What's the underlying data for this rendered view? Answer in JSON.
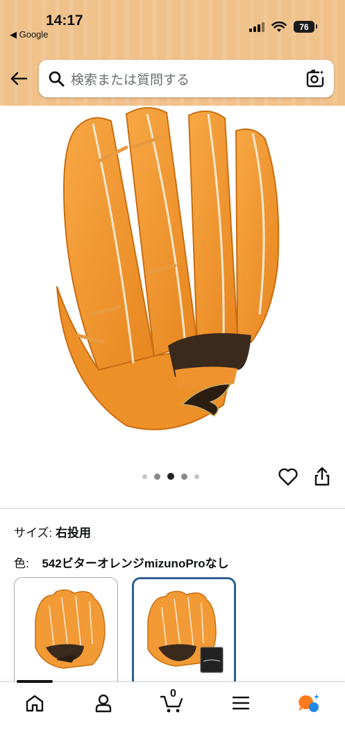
{
  "status_bar": {
    "time": "14:17",
    "back_app": "◀ Google",
    "battery": "76"
  },
  "search": {
    "placeholder": "検索または質問する"
  },
  "product": {
    "image_alt": "MIZUNO glove",
    "carousel": {
      "count": 5,
      "active_index": 3
    }
  },
  "details": {
    "size_label": "サイズ:",
    "size_value": "右投用",
    "color_label": "色:",
    "color_value": "542ビターオレンジmizunoProなし"
  },
  "variants": [
    {
      "name": "without-bag",
      "selected": false
    },
    {
      "name": "with-bag",
      "selected": true
    }
  ],
  "bottom_nav": {
    "items": [
      "home",
      "account",
      "cart",
      "menu",
      "assistant"
    ],
    "cart_count": "0"
  },
  "colors": {
    "header_bg": "#f0c18a",
    "glove_orange": "#f29a35",
    "selected_border": "#2e5f93"
  }
}
